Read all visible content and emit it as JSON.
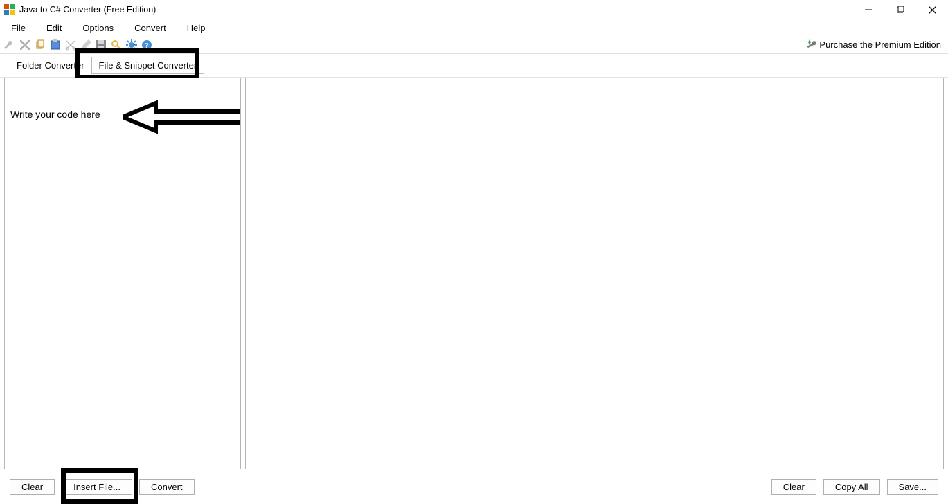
{
  "title": "Java to C# Converter (Free Edition)",
  "menubar": {
    "file": "File",
    "edit": "Edit",
    "options": "Options",
    "convert": "Convert",
    "help": "Help"
  },
  "toolbar": {
    "purchase_label": "Purchase the Premium Edition"
  },
  "tabs": {
    "folder": "Folder Converter",
    "file_snippet": "File & Snippet Converter"
  },
  "editor": {
    "placeholder_annotation": "Write your code here"
  },
  "buttons_left": {
    "clear": "Clear",
    "insert_file": "Insert File...",
    "convert": "Convert"
  },
  "buttons_right": {
    "clear": "Clear",
    "copy_all": "Copy All",
    "save": "Save..."
  }
}
